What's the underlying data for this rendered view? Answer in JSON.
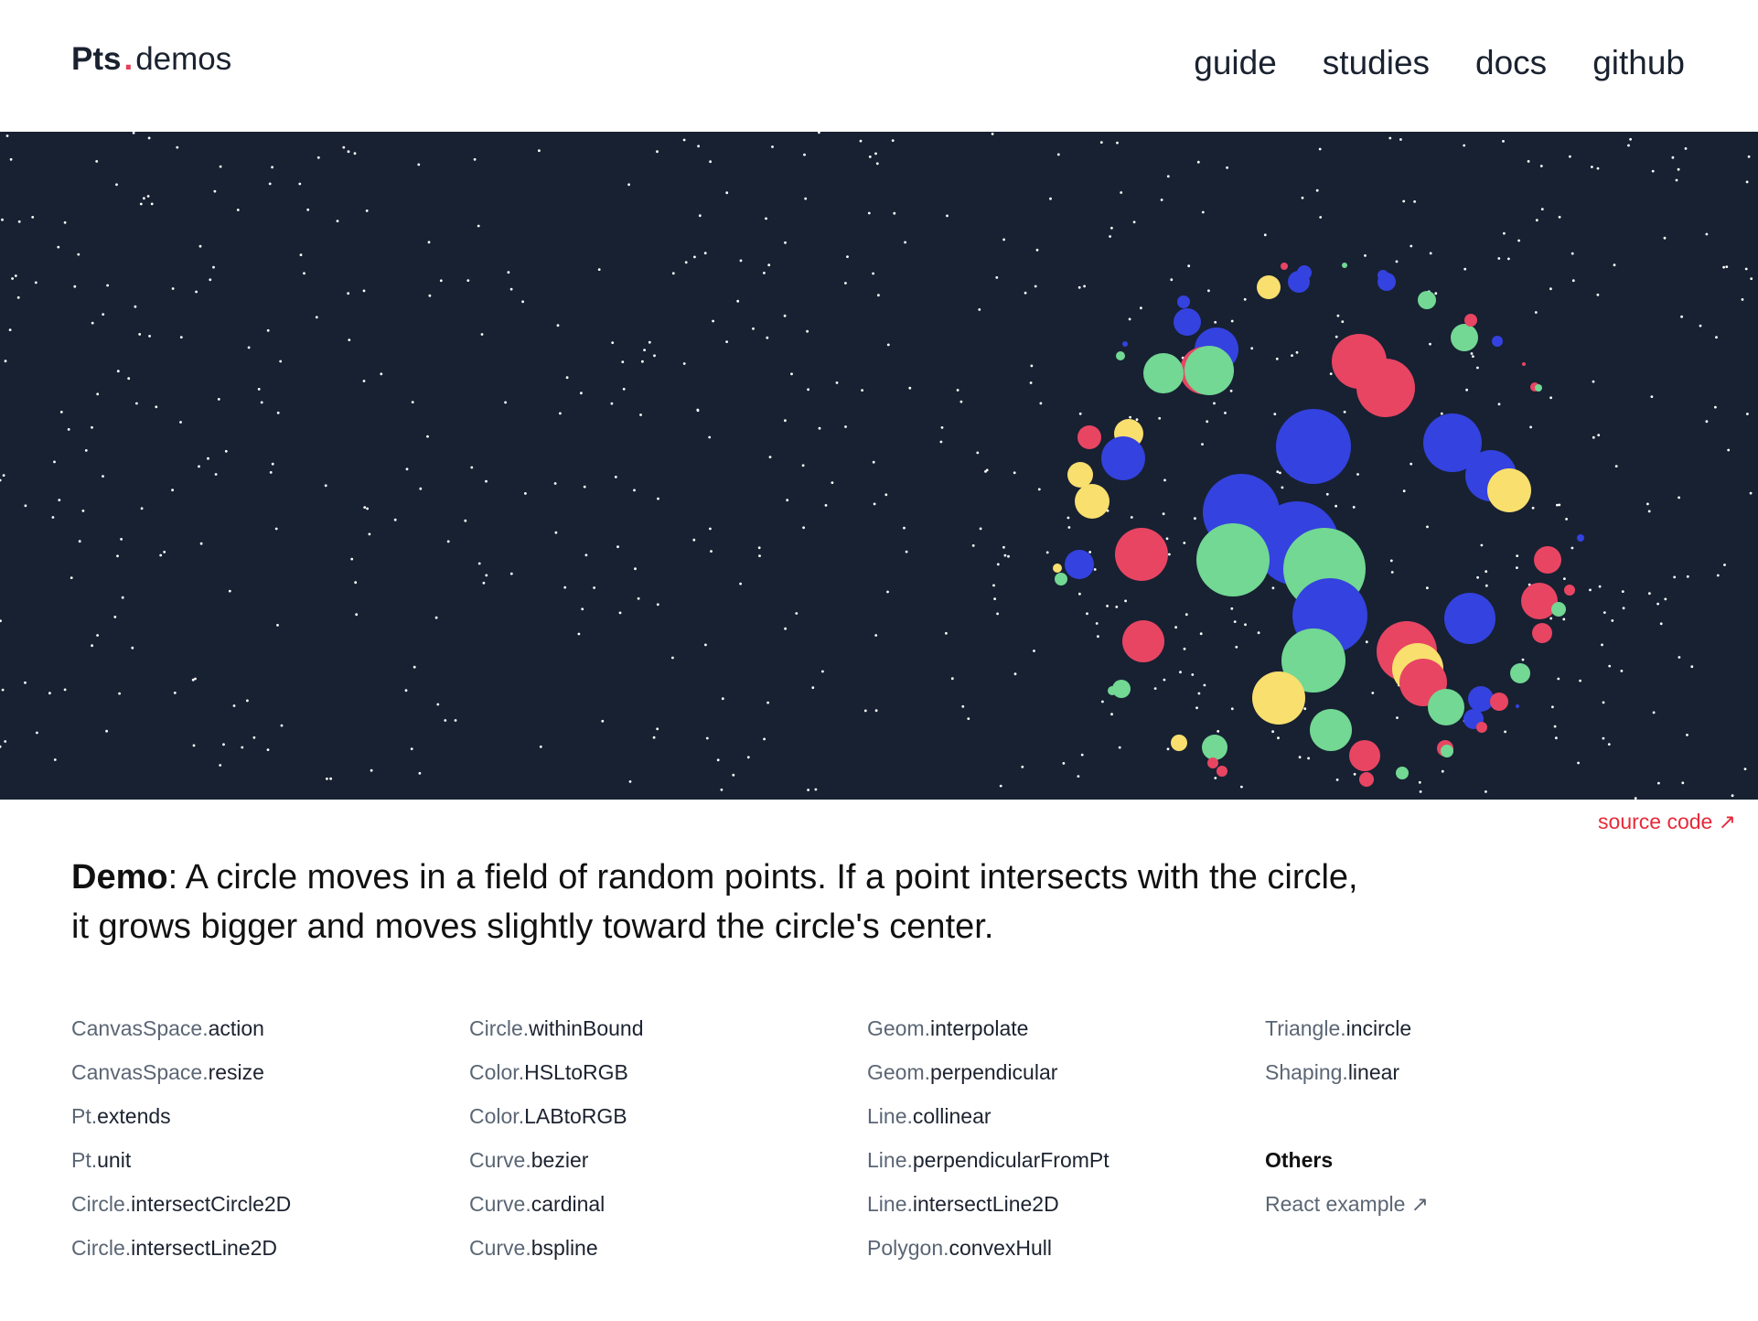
{
  "header": {
    "brand_bold": "Pts",
    "brand_dot": ".",
    "brand_name": "demos",
    "nav": [
      "guide",
      "studies",
      "docs",
      "github"
    ]
  },
  "canvas": {
    "background": "#172132",
    "colors": {
      "blue": "#3442df",
      "green": "#72d893",
      "red": "#e84563",
      "yellow": "#f9df6e",
      "point": "#ffffff"
    }
  },
  "source_link": "source code ↗",
  "description": {
    "label": "Demo",
    "text": ": A circle moves in a field of random points. If a point intersects with the circle, it grows bigger and moves slightly toward the circle's center."
  },
  "api_columns": [
    [
      {
        "cls": "CanvasSpace.",
        "method": "action"
      },
      {
        "cls": "CanvasSpace.",
        "method": "resize"
      },
      {
        "cls": "Pt.",
        "method": "extends"
      },
      {
        "cls": "Pt.",
        "method": "unit"
      },
      {
        "cls": "Circle.",
        "method": "intersectCircle2D"
      },
      {
        "cls": "Circle.",
        "method": "intersectLine2D"
      }
    ],
    [
      {
        "cls": "Circle.",
        "method": "withinBound"
      },
      {
        "cls": "Color.",
        "method": "HSLtoRGB"
      },
      {
        "cls": "Color.",
        "method": "LABtoRGB"
      },
      {
        "cls": "Curve.",
        "method": "bezier"
      },
      {
        "cls": "Curve.",
        "method": "cardinal"
      },
      {
        "cls": "Curve.",
        "method": "bspline"
      }
    ],
    [
      {
        "cls": "Geom.",
        "method": "interpolate"
      },
      {
        "cls": "Geom.",
        "method": "perpendicular"
      },
      {
        "cls": "Line.",
        "method": "collinear"
      },
      {
        "cls": "Line.",
        "method": "perpendicularFromPt"
      },
      {
        "cls": "Line.",
        "method": "intersectLine2D"
      },
      {
        "cls": "Polygon.",
        "method": "convexHull"
      }
    ],
    [
      {
        "cls": "Triangle.",
        "method": "incircle"
      },
      {
        "cls": "Shaping.",
        "method": "linear"
      }
    ]
  ],
  "others": {
    "title": "Others",
    "react_label": "React example ↗"
  }
}
